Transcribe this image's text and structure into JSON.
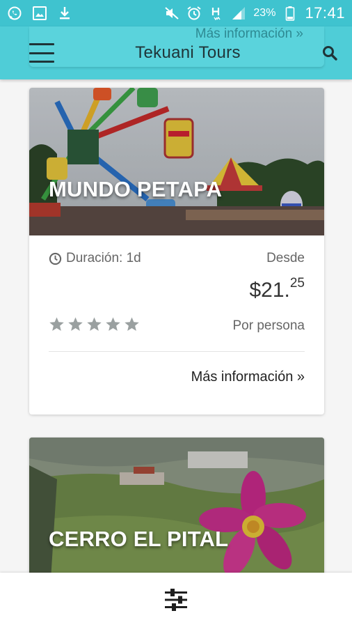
{
  "status_bar": {
    "battery_percent": "23%",
    "time": "17:41",
    "left_icons": [
      "whatsapp-icon",
      "image-icon",
      "download-icon"
    ],
    "right_icons": [
      "mute-icon",
      "alarm-icon",
      "signal-h-icon",
      "signal-bars-icon",
      "battery-icon"
    ]
  },
  "app_bar": {
    "title": "Tekuani Tours",
    "ghost_link": "Más información »",
    "menu_icon": "hamburger-menu-icon",
    "search_icon": "search-icon"
  },
  "tours": [
    {
      "name": "MUNDO PETAPA",
      "duration": "Duración: 1d",
      "from_label": "Desde",
      "price_main": "$21.",
      "price_cents": "25",
      "per_person": "Por persona",
      "rating": 5,
      "more_link": "Más información »"
    },
    {
      "name": "CERRO EL PITAL"
    }
  ],
  "bottom_bar": {
    "filter_icon": "sliders-filter-icon"
  },
  "colors": {
    "status_bar": "#3fc3cf",
    "app_bar": "#4fcdd7",
    "star": "#9aa0a0",
    "card_bg": "#ffffff"
  }
}
